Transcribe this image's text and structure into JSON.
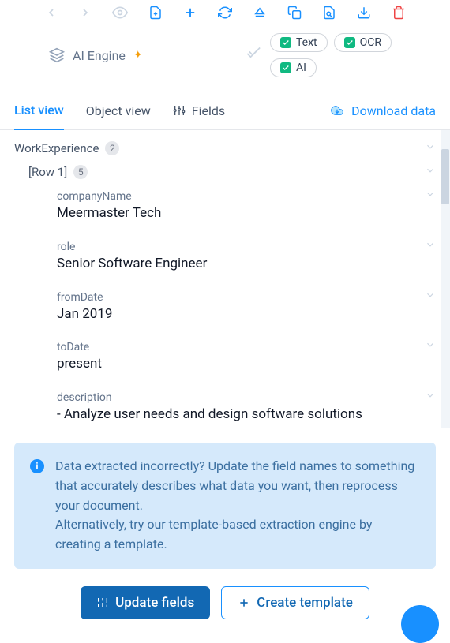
{
  "engine": {
    "name": "AI Engine"
  },
  "chips": {
    "text": "Text",
    "ocr": "OCR",
    "ai": "AI"
  },
  "tabs": {
    "list": "List view",
    "object": "Object view",
    "fields": "Fields"
  },
  "download": "Download data",
  "tree": {
    "section": {
      "label": "WorkExperience",
      "count": "2"
    },
    "row": {
      "label": "[Row 1]",
      "count": "5"
    },
    "fields": {
      "companyName": {
        "label": "companyName",
        "value": "Meermaster Tech"
      },
      "role": {
        "label": "role",
        "value": "Senior Software Engineer"
      },
      "fromDate": {
        "label": "fromDate",
        "value": "Jan 2019"
      },
      "toDate": {
        "label": "toDate",
        "value": "present"
      },
      "description": {
        "label": "description",
        "value": "- Analyze user needs and design software solutions"
      }
    }
  },
  "alert": {
    "line1": "Data extracted incorrectly? Update the field names to something that accurately describes what data you want, then reprocess your document.",
    "line2": "Alternatively, try our template-based extraction engine by creating a template."
  },
  "buttons": {
    "update": "Update fields",
    "create": "Create template"
  }
}
